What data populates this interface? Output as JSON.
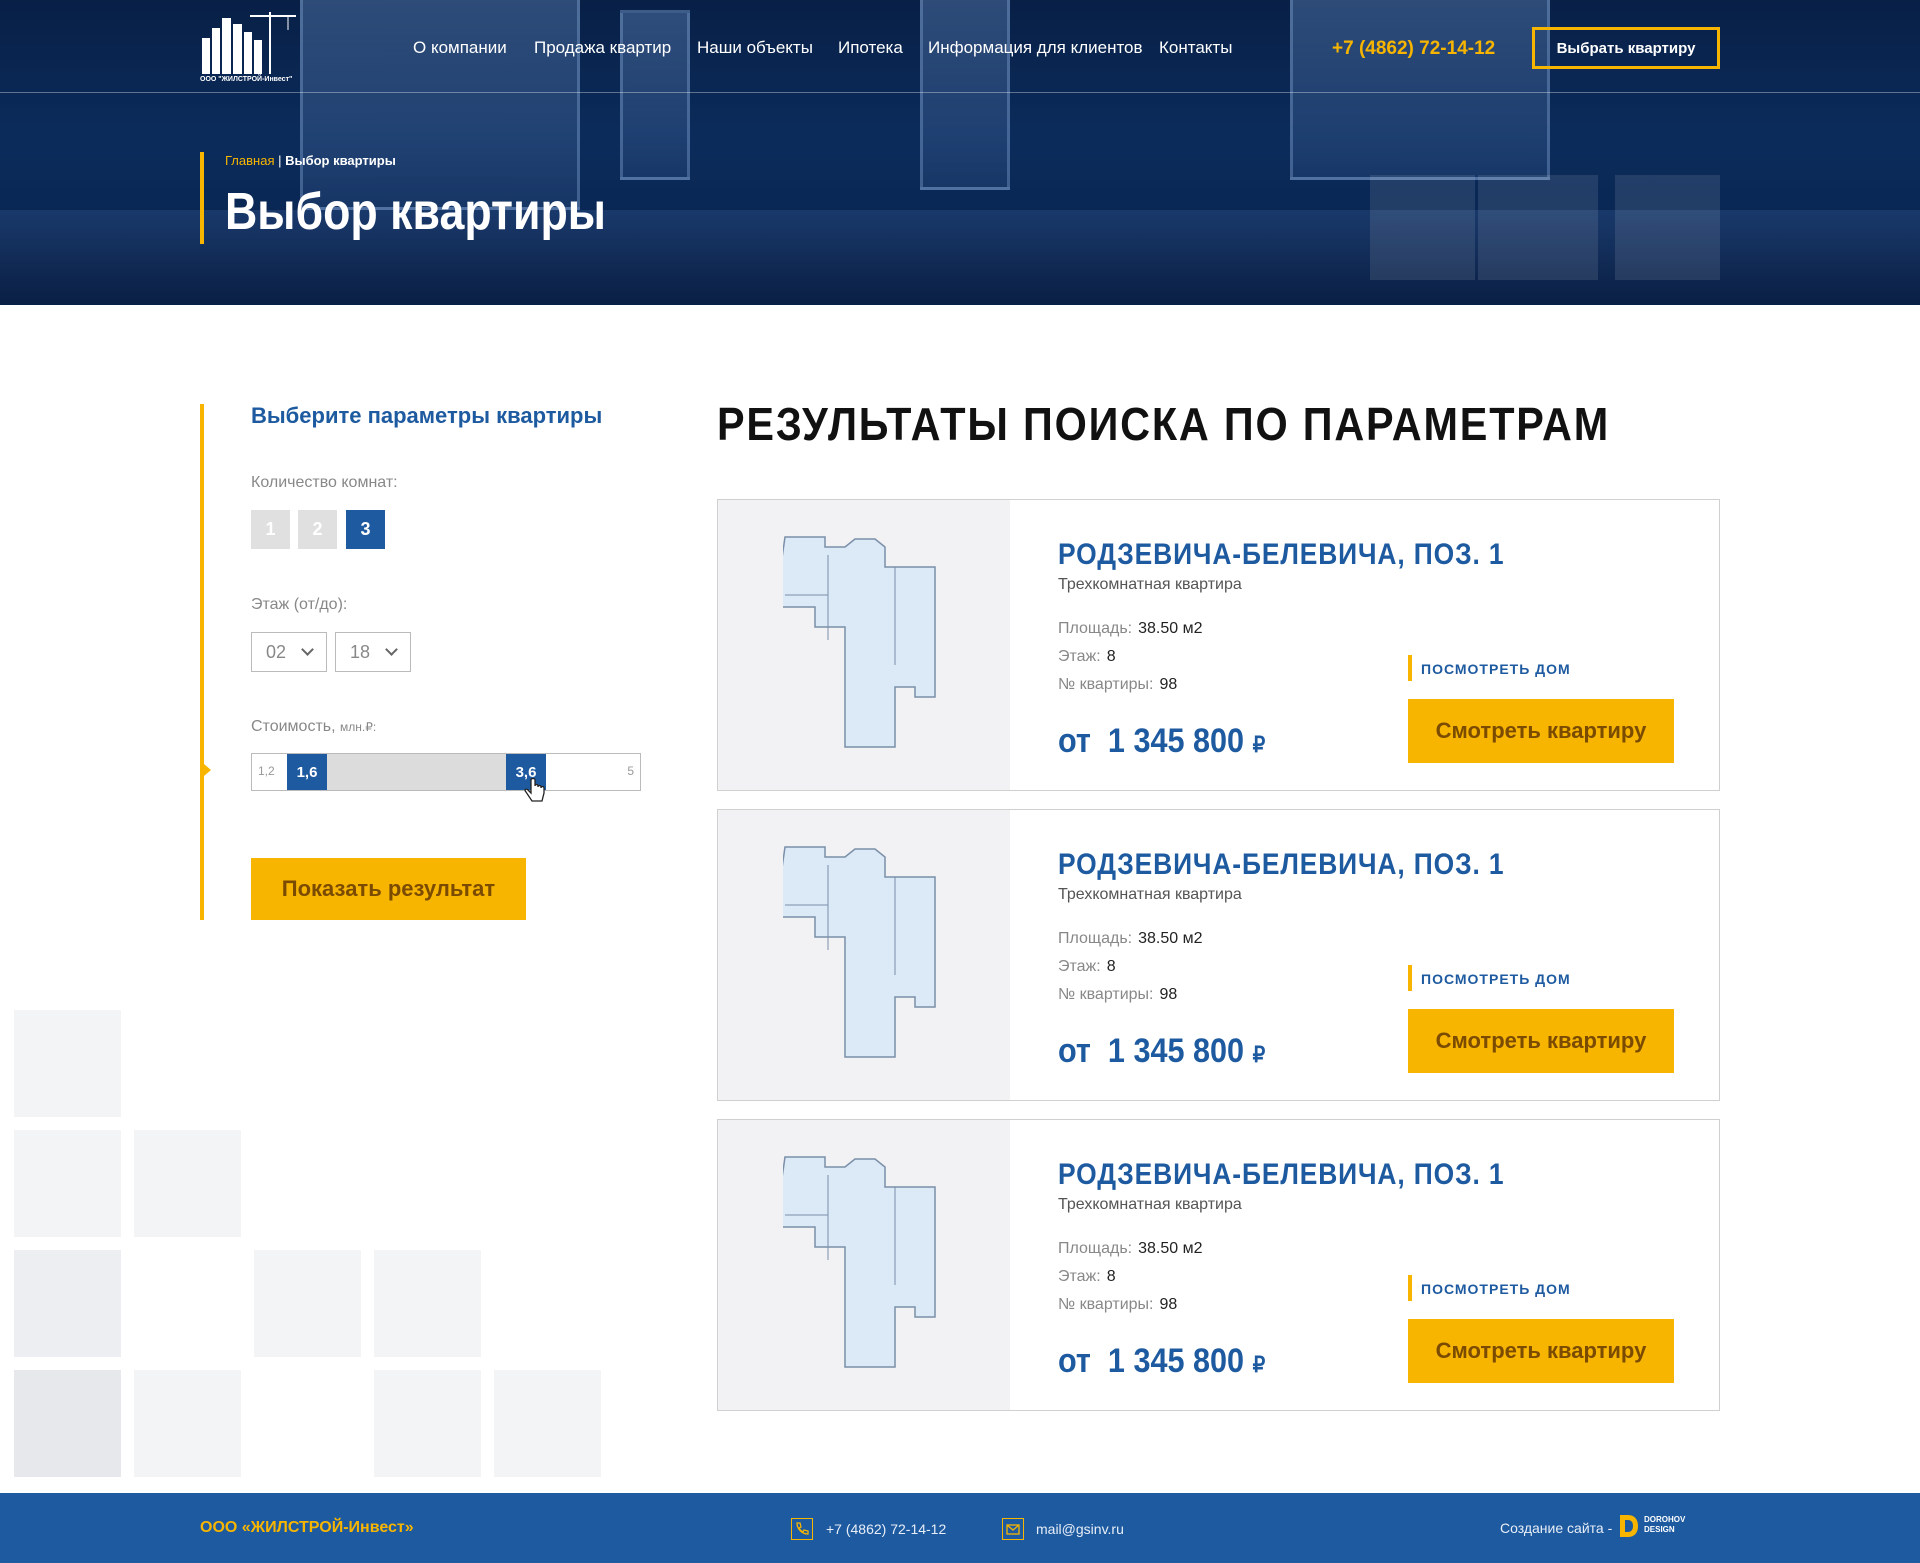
{
  "header": {
    "logo_caption": "ООО \"ЖИЛСТРОЙ-Инвест\"",
    "nav": [
      "О компании",
      "Продажа квартир",
      "Наши объекты",
      "Ипотека",
      "Информация для клиентов",
      "Контакты"
    ],
    "phone": "+7 (4862) 72-14-12",
    "cta_label": "Выбрать квартиру"
  },
  "breadcrumb": {
    "home": "Главная",
    "separator": " | ",
    "current": "Выбор квартиры"
  },
  "page_title": "Выбор квартиры",
  "filter": {
    "title": "Выберите параметры квартиры",
    "rooms_label": "Количество комнат:",
    "rooms": [
      "1",
      "2",
      "3"
    ],
    "rooms_selected": "3",
    "floor_label": "Этаж (от/до):",
    "floor_from": "02",
    "floor_to": "18",
    "price_label": "Стоимость,",
    "price_unit": "млн.₽:",
    "price_min": "1,2",
    "price_max": "5",
    "price_from": "1,6",
    "price_to": "3,6",
    "submit_label": "Показать результат"
  },
  "results": {
    "title": "РЕЗУЛЬТАТЫ ПОИСКА ПО ПАРАМЕТРАМ",
    "items": [
      {
        "name": "РОДЗЕВИЧА-БЕЛЕВИЧА, ПОЗ. 1",
        "type": "Трехкомнатная квартира",
        "area_label": "Площадь:",
        "area": "38.50 м2",
        "floor_label": "Этаж:",
        "floor": "8",
        "number_label": "№ квартиры:",
        "number": "98",
        "price_prefix": "от",
        "price": "1 345 800",
        "currency": "₽",
        "house_link": "ПОСМОТРЕТЬ ДОМ",
        "view_label": "Смотреть квартиру"
      },
      {
        "name": "РОДЗЕВИЧА-БЕЛЕВИЧА, ПОЗ. 1",
        "type": "Трехкомнатная квартира",
        "area_label": "Площадь:",
        "area": "38.50 м2",
        "floor_label": "Этаж:",
        "floor": "8",
        "number_label": "№ квартиры:",
        "number": "98",
        "price_prefix": "от",
        "price": "1 345 800",
        "currency": "₽",
        "house_link": "ПОСМОТРЕТЬ ДОМ",
        "view_label": "Смотреть квартиру"
      },
      {
        "name": "РОДЗЕВИЧА-БЕЛЕВИЧА, ПОЗ. 1",
        "type": "Трехкомнатная квартира",
        "area_label": "Площадь:",
        "area": "38.50 м2",
        "floor_label": "Этаж:",
        "floor": "8",
        "number_label": "№ квартиры:",
        "number": "98",
        "price_prefix": "от",
        "price": "1 345 800",
        "currency": "₽",
        "house_link": "ПОСМОТРЕТЬ ДОМ",
        "view_label": "Смотреть квартиру"
      }
    ]
  },
  "footer": {
    "company": "ООО «ЖИЛСТРОЙ-Инвест»",
    "phone": "+7 (4862) 72-14-12",
    "email": "mail@gsinv.ru",
    "creator_label": "Создание сайта -",
    "creator_brand_1": "DOROHOV",
    "creator_brand_2": "DESIGN"
  },
  "colors": {
    "accent": "#f7b500",
    "brand_blue": "#1d5aa0",
    "text_dark": "#111111"
  },
  "icons": [
    "building-logo-icon",
    "chevron-down-icon",
    "pointer-cursor-icon",
    "phone-icon",
    "mail-icon",
    "dorohov-logo-icon"
  ]
}
